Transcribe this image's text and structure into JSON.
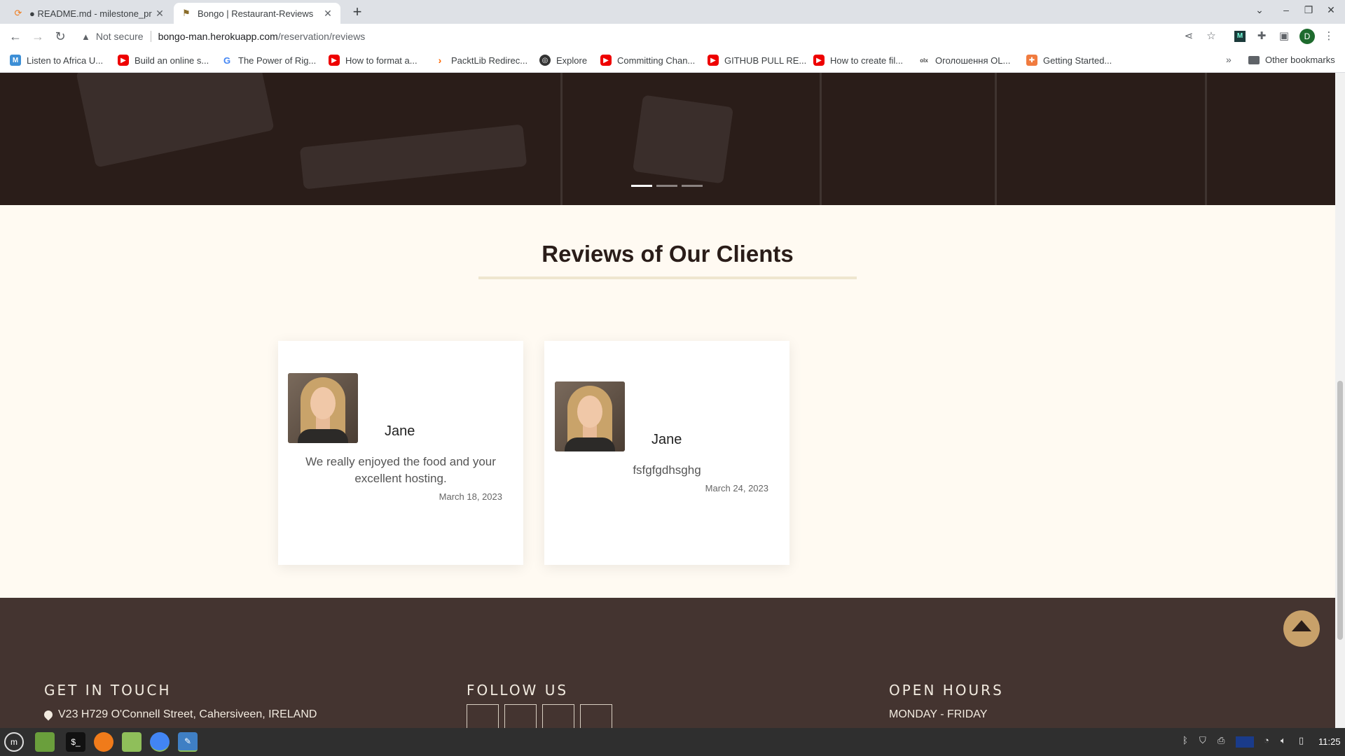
{
  "browser": {
    "tabs": [
      {
        "title": "● README.md - milestone_pr",
        "favicon": "code-editor-icon",
        "active": false
      },
      {
        "title": "Bongo | Restaurant-Reviews",
        "favicon": "restaurant-icon",
        "active": true
      }
    ],
    "new_tab": "+",
    "security_label": "Not secure",
    "url_host": "bongo-man.herokuapp.com",
    "url_path": "/reservation/reviews",
    "profile_initial": "D",
    "bookmarks": [
      {
        "label": "Listen to Africa U...",
        "icon": "m-icon"
      },
      {
        "label": "Build an online s...",
        "icon": "youtube-icon"
      },
      {
        "label": "The Power of Rig...",
        "icon": "google-icon"
      },
      {
        "label": "How to format a...",
        "icon": "youtube-icon"
      },
      {
        "label": "PacktLib Redirec...",
        "icon": "packt-icon"
      },
      {
        "label": "Explore",
        "icon": "explore-icon"
      },
      {
        "label": "Committing Chan...",
        "icon": "youtube-icon"
      },
      {
        "label": "GITHUB PULL RE...",
        "icon": "youtube-icon"
      },
      {
        "label": "How to create fil...",
        "icon": "youtube-icon"
      },
      {
        "label": "Оголошення OL...",
        "icon": "olx-icon"
      },
      {
        "label": "Getting Started...",
        "icon": "getting-started-icon"
      }
    ],
    "bookmarks_more": "»",
    "other_bookmarks": "Other bookmarks"
  },
  "page": {
    "section_title": "Reviews of Our Clients",
    "carousel_slides": 3,
    "carousel_active": 1,
    "reviews": [
      {
        "name": "Jane",
        "text": "We really enjoyed the food and your excellent hosting.",
        "date": "March 18, 2023"
      },
      {
        "name": "Jane",
        "text": "fsfgfgdhsghg",
        "date": "March 24, 2023"
      }
    ],
    "footer": {
      "get_in_touch": "GET IN TOUCH",
      "address": "V23 H729 O'Connell Street, Cahersiveen, IRELAND",
      "follow_us": "FOLLOW US",
      "open_hours": "OPEN HOURS",
      "hours_days": "MONDAY - FRIDAY"
    }
  },
  "os": {
    "clock": "11:25"
  },
  "colors": {
    "hero_bg": "#2a1d19",
    "page_bg": "#fffaf2",
    "footer_bg": "#443430",
    "accent": "#c8a16a"
  }
}
